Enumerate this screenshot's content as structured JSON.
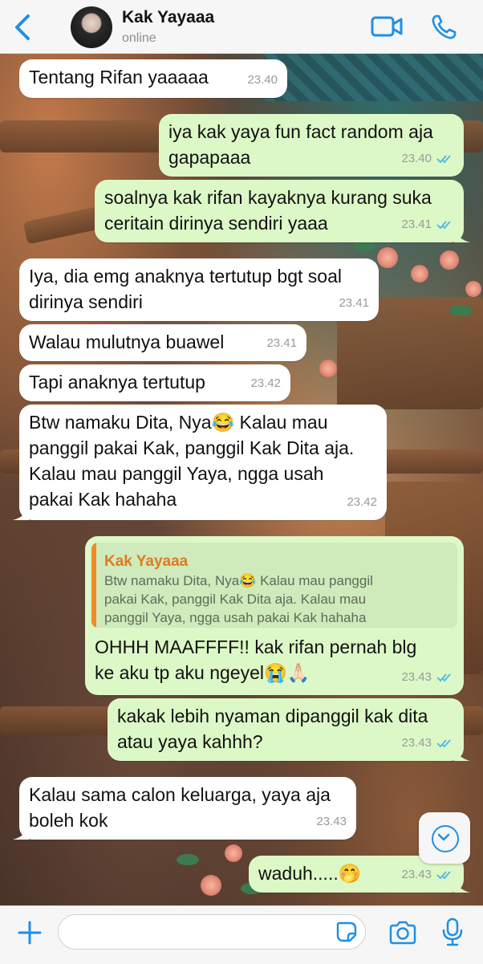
{
  "header": {
    "contact_name": "Kak Yayaaa",
    "status": "online",
    "icons": [
      "chevron-left-icon",
      "video-camera-icon",
      "phone-icon"
    ]
  },
  "messages": [
    {
      "direction": "in",
      "text": [
        "Tentang Rifan yaaaaa"
      ],
      "time": "23.40"
    },
    {
      "direction": "out",
      "text": [
        "iya kak yaya fun fact random aja",
        "gapapaaa"
      ],
      "time": "23.40",
      "read": true
    },
    {
      "direction": "out",
      "text": [
        "soalnya kak rifan kayaknya kurang suka",
        "ceritain dirinya sendiri yaaa"
      ],
      "time": "23.41",
      "read": true
    },
    {
      "direction": "in",
      "text": [
        "Iya, dia emg anaknya tertutup bgt soal",
        "dirinya sendiri"
      ],
      "time": "23.41"
    },
    {
      "direction": "in",
      "text": [
        "Walau mulutnya buawel"
      ],
      "time": "23.41"
    },
    {
      "direction": "in",
      "text": [
        "Tapi anaknya tertutup"
      ],
      "time": "23.42"
    },
    {
      "direction": "in",
      "text": [
        "Btw namaku Dita, Nya😂 Kalau mau",
        "panggil pakai Kak, panggil Kak Dita aja.",
        "Kalau mau panggil Yaya, ngga usah",
        "pakai Kak hahaha"
      ],
      "time": "23.42"
    },
    {
      "direction": "out",
      "quote": {
        "name": "Kak Yayaaa",
        "text": [
          "Btw namaku Dita, Nya😂 Kalau mau panggil",
          "pakai Kak, panggil Kak Dita aja. Kalau mau",
          "panggil Yaya, ngga usah pakai Kak hahaha"
        ]
      },
      "text": [
        "OHHH MAAFFFF!! kak rifan pernah blg",
        "ke aku tp aku ngeyel😭🙏🏻"
      ],
      "time": "23.43",
      "read": true
    },
    {
      "direction": "out",
      "text": [
        "kakak lebih nyaman dipanggil kak dita",
        "atau yaya kahhh?"
      ],
      "time": "23.43",
      "read": true
    },
    {
      "direction": "in",
      "text": [
        "Kalau sama calon keluarga, yaya aja",
        "boleh kok"
      ],
      "time": "23.43"
    },
    {
      "direction": "out",
      "text": [
        "waduh.....🤭"
      ],
      "time": "23.43",
      "read": true
    }
  ],
  "input_bar": {
    "placeholder": "",
    "icons": [
      "plus-icon",
      "sticker-icon",
      "camera-icon",
      "microphone-icon"
    ]
  },
  "colors": {
    "accent": "#1f8fe6",
    "incoming_bubble": "#ffffff",
    "outgoing_bubble": "#dcf8c6",
    "read_ticks": "#4fb6ec",
    "quote_name": "#e07a1f"
  }
}
